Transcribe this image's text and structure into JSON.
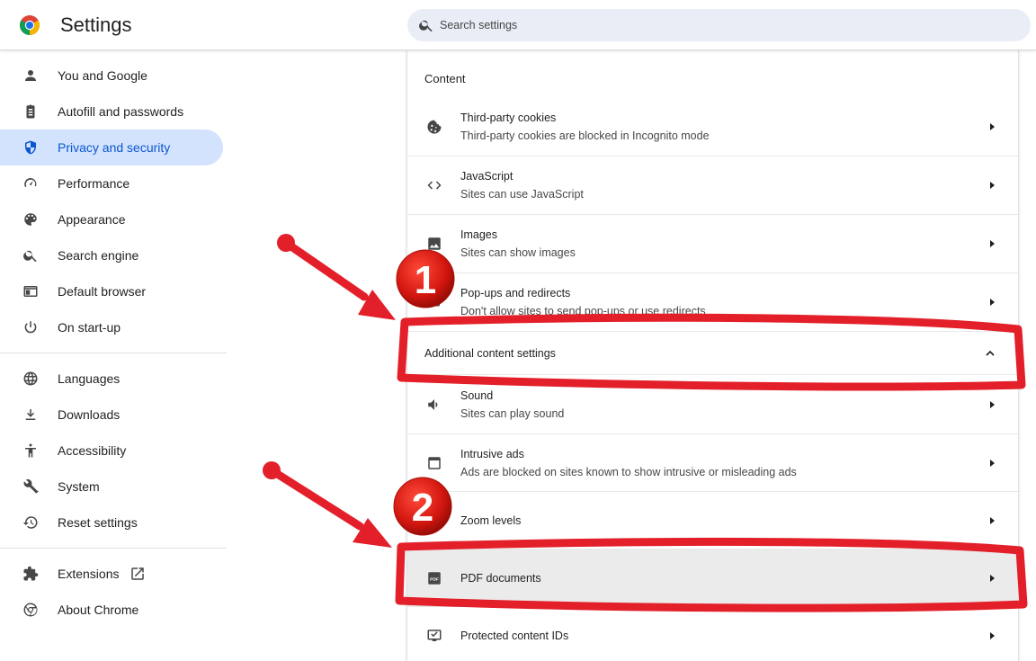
{
  "header": {
    "title": "Settings",
    "search_placeholder": "Search settings"
  },
  "sidebar": {
    "items": [
      {
        "label": "You and Google",
        "icon": "person-icon"
      },
      {
        "label": "Autofill and passwords",
        "icon": "clipboard-icon"
      },
      {
        "label": "Privacy and security",
        "icon": "shield-icon",
        "active": true
      },
      {
        "label": "Performance",
        "icon": "speedometer-icon"
      },
      {
        "label": "Appearance",
        "icon": "palette-icon"
      },
      {
        "label": "Search engine",
        "icon": "search-icon"
      },
      {
        "label": "Default browser",
        "icon": "browser-window-icon"
      },
      {
        "label": "On start-up",
        "icon": "power-icon"
      },
      {
        "label": "Languages",
        "icon": "globe-icon"
      },
      {
        "label": "Downloads",
        "icon": "download-icon"
      },
      {
        "label": "Accessibility",
        "icon": "accessibility-icon"
      },
      {
        "label": "System",
        "icon": "wrench-icon"
      },
      {
        "label": "Reset settings",
        "icon": "history-icon"
      },
      {
        "label": "Extensions",
        "icon": "puzzle-icon"
      },
      {
        "label": "About Chrome",
        "icon": "chrome-icon"
      }
    ]
  },
  "content": {
    "section_title": "Content",
    "rows": [
      {
        "title": "Third-party cookies",
        "subtitle": "Third-party cookies are blocked in Incognito mode",
        "icon": "cookie-icon"
      },
      {
        "title": "JavaScript",
        "subtitle": "Sites can use JavaScript",
        "icon": "code-icon"
      },
      {
        "title": "Images",
        "subtitle": "Sites can show images",
        "icon": "image-icon"
      },
      {
        "title": "Pop-ups and redirects",
        "subtitle": "Don't allow sites to send pop-ups or use redirects",
        "icon": "popup-icon"
      },
      {
        "title": "Additional content settings",
        "icon": "chevron-up-icon"
      },
      {
        "title": "Sound",
        "subtitle": "Sites can play sound",
        "icon": "speaker-icon"
      },
      {
        "title": "Intrusive ads",
        "subtitle": "Ads are blocked on sites known to show intrusive or misleading ads",
        "icon": "ad-window-icon"
      },
      {
        "title": "Zoom levels",
        "icon": "zoom-icon"
      },
      {
        "title": "PDF documents",
        "icon": "pdf-icon"
      },
      {
        "title": "Protected content IDs",
        "icon": "monitor-check-icon"
      }
    ]
  },
  "annotations": {
    "badge1": "1",
    "badge2": "2",
    "color": "#e3202a"
  }
}
